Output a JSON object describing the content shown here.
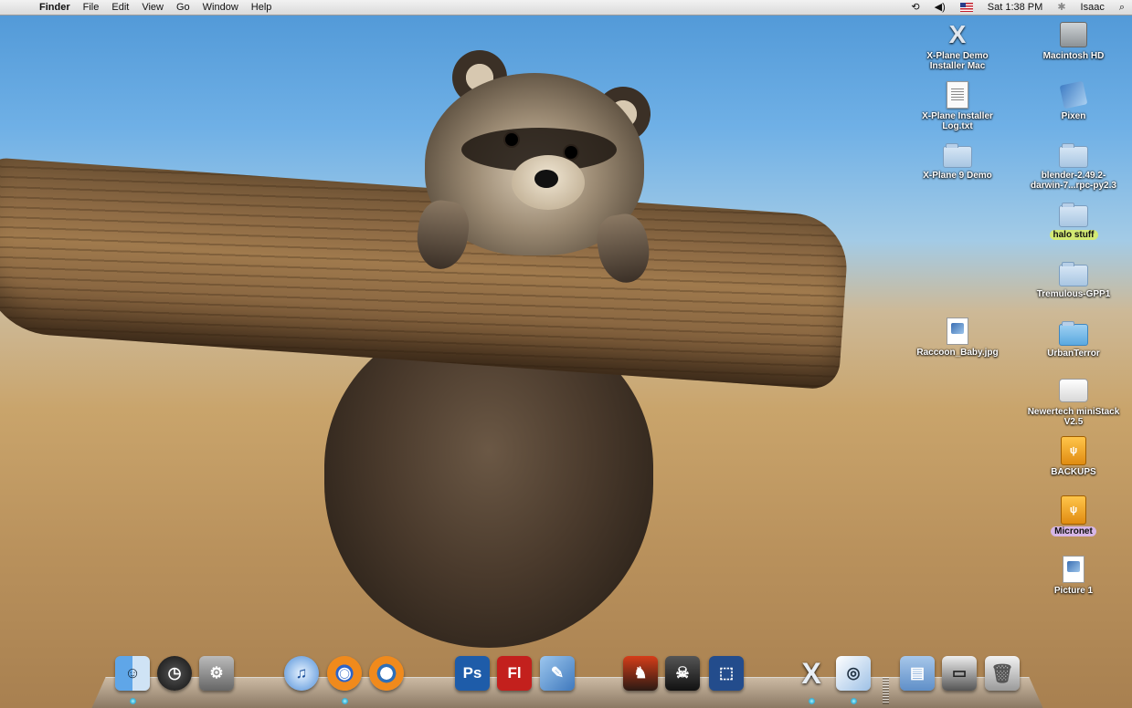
{
  "menubar": {
    "app_name": "Finder",
    "menus": [
      "File",
      "Edit",
      "View",
      "Go",
      "Window",
      "Help"
    ],
    "clock": "Sat 1:38 PM",
    "user": "Isaac"
  },
  "desktop_icons": {
    "xplane_demo_installer": "X-Plane Demo Installer Mac",
    "macintosh_hd": "Macintosh HD",
    "xplane_installer_log": "X-Plane Installer Log.txt",
    "pixen": "Pixen",
    "xplane9_demo": "X-Plane 9 Demo",
    "blender": "blender-2.49.2-darwin-7...rpc-py2.3",
    "halo_stuff": "halo stuff",
    "tremulous": "Tremulous-GPP1",
    "raccoon_baby": "Raccoon_Baby.jpg",
    "urbanterror": "UrbanTerror",
    "newertech": "Newertech miniStack V2.5",
    "backups": "BACKUPS",
    "micronet": "Micronet",
    "picture1": "Picture 1"
  },
  "dock": {
    "items": [
      {
        "name": "Finder",
        "glyph": "☺"
      },
      {
        "name": "Dashboard",
        "glyph": "◷"
      },
      {
        "name": "System Preferences",
        "glyph": "⚙"
      },
      {
        "name": "iTunes",
        "glyph": "♫"
      },
      {
        "name": "Firefox",
        "glyph": "◉"
      },
      {
        "name": "Blender",
        "glyph": "◐"
      },
      {
        "name": "Photoshop",
        "glyph": "Ps"
      },
      {
        "name": "Flash",
        "glyph": "Fl"
      },
      {
        "name": "Pixen",
        "glyph": "✎"
      },
      {
        "name": "Game 1",
        "glyph": "♞"
      },
      {
        "name": "Game 2",
        "glyph": "☠"
      },
      {
        "name": "App",
        "glyph": "⬚"
      },
      {
        "name": "X11",
        "glyph": "X"
      },
      {
        "name": "Preview",
        "glyph": "◎"
      },
      {
        "name": "Documents",
        "glyph": "▤"
      },
      {
        "name": "Downloads",
        "glyph": "▭"
      },
      {
        "name": "Trash",
        "glyph": "🗑"
      }
    ]
  },
  "colors": {
    "menubar": "#e6e6e6",
    "sky": "#5aa3de",
    "ground": "#c29d62"
  }
}
